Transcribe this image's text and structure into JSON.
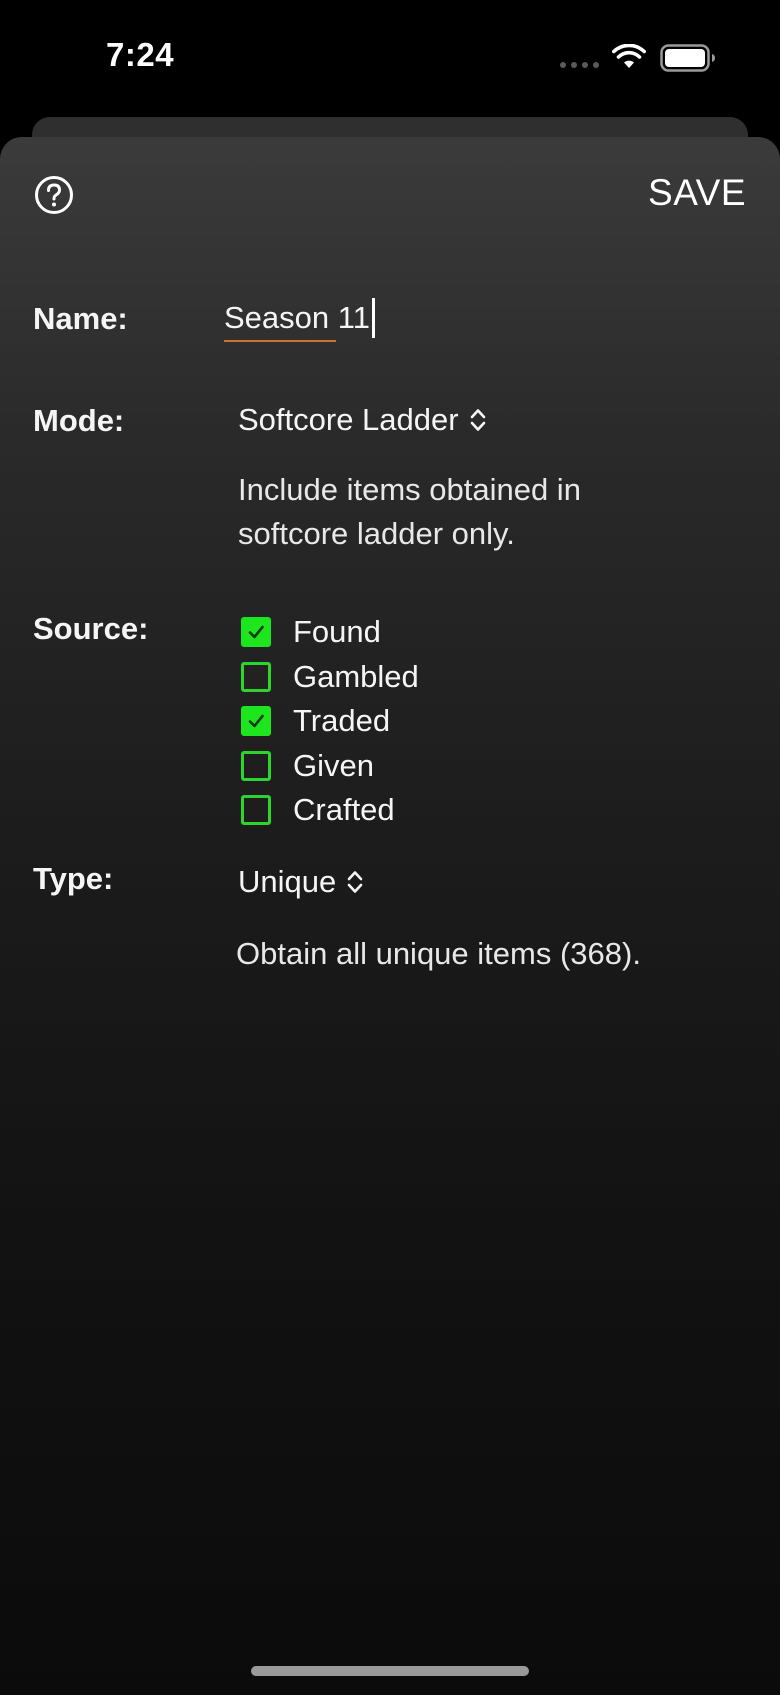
{
  "status_bar": {
    "time": "7:24",
    "icons": [
      "cellular-dots-icon",
      "wifi-icon",
      "battery-icon"
    ]
  },
  "toolbar": {
    "help_icon": "question-circle-icon",
    "save_label": "SAVE"
  },
  "form": {
    "name": {
      "label": "Name:",
      "value": "Season 11"
    },
    "mode": {
      "label": "Mode:",
      "selected": "Softcore Ladder",
      "description": "Include items obtained in softcore ladder only."
    },
    "source": {
      "label": "Source:",
      "options": [
        {
          "label": "Found",
          "checked": true
        },
        {
          "label": "Gambled",
          "checked": false
        },
        {
          "label": "Traded",
          "checked": true
        },
        {
          "label": "Given",
          "checked": false
        },
        {
          "label": "Crafted",
          "checked": false
        }
      ]
    },
    "type": {
      "label": "Type:",
      "selected": "Unique",
      "description": "Obtain all unique items (368)."
    }
  },
  "colors": {
    "checkbox_accent": "#1ee61e",
    "spellcheck_underline": "#c9752f",
    "background": "#000000"
  }
}
